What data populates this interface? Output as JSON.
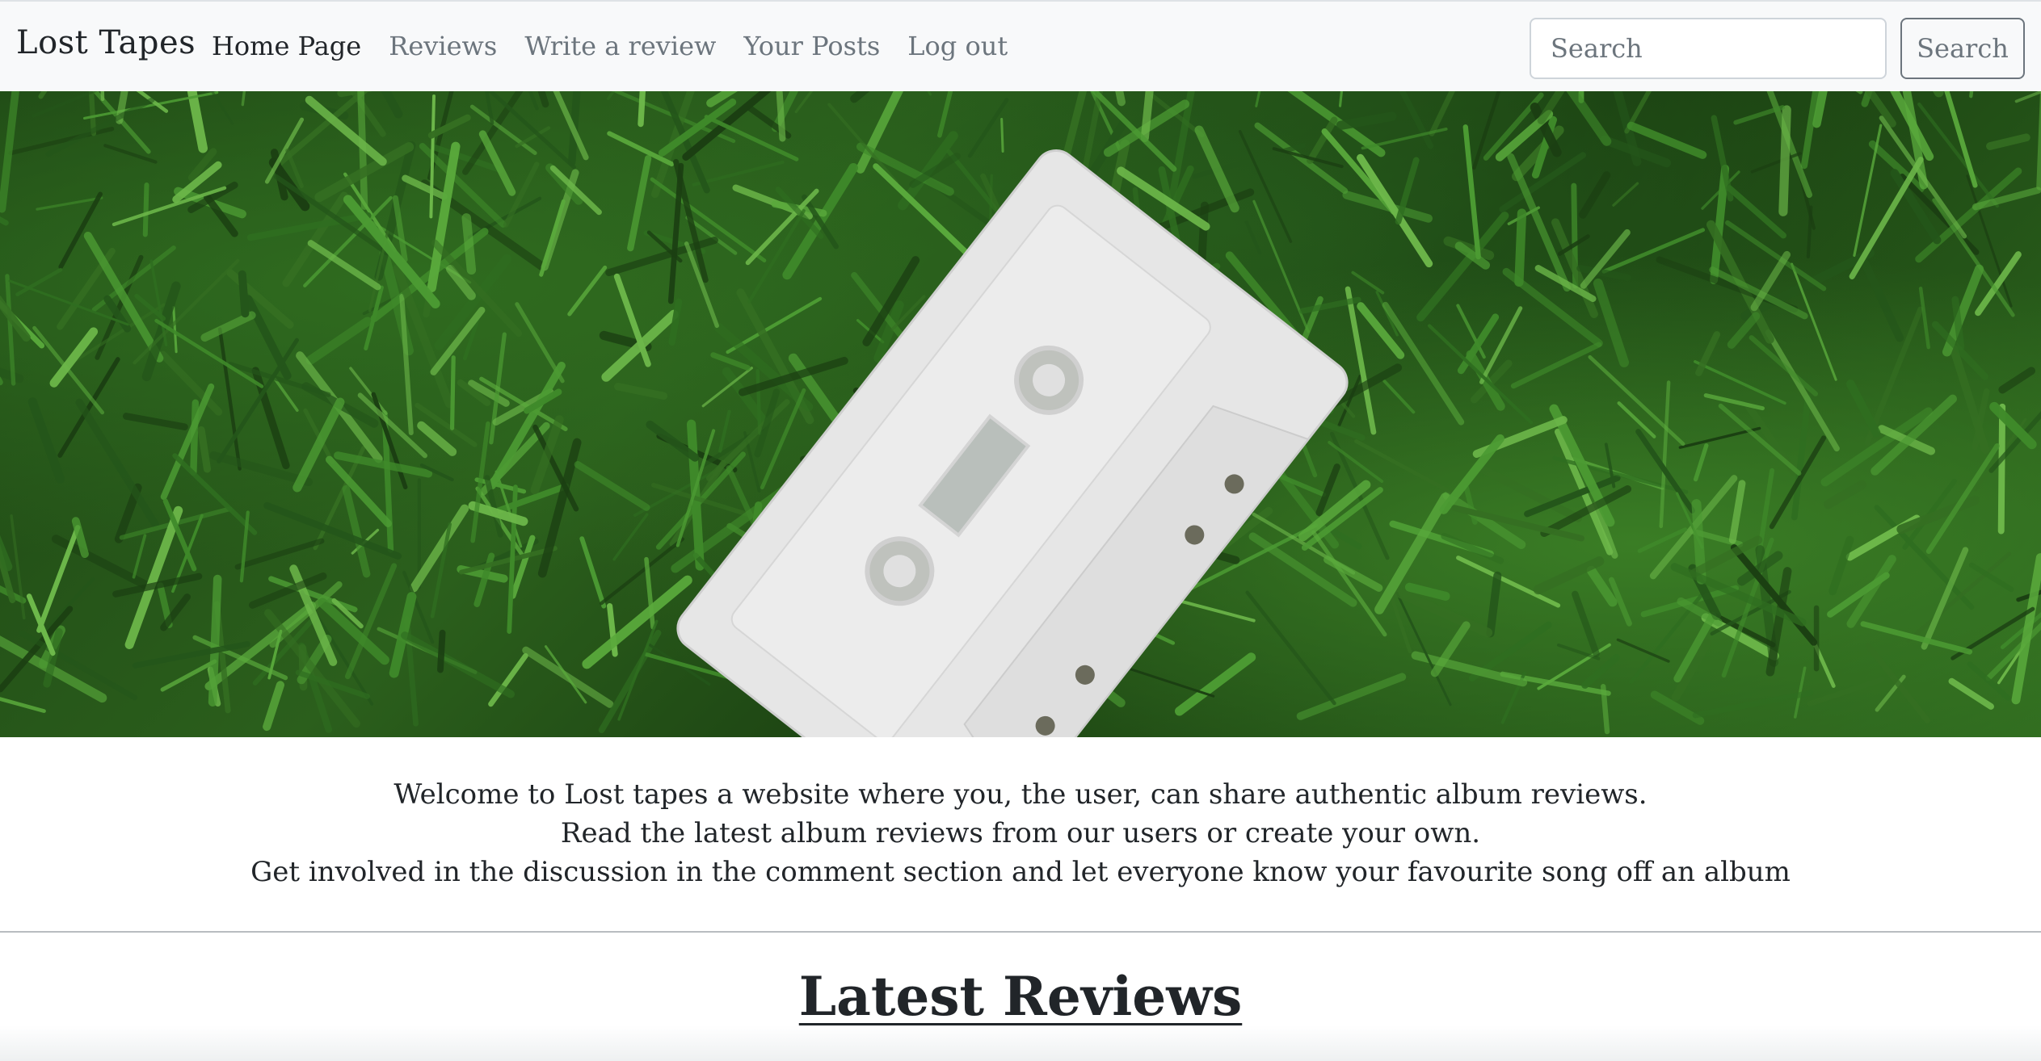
{
  "navbar": {
    "brand": "Lost Tapes",
    "links": [
      {
        "label": "Home Page",
        "active": true
      },
      {
        "label": "Reviews",
        "active": false
      },
      {
        "label": "Write a review",
        "active": false
      },
      {
        "label": "Your Posts",
        "active": false
      },
      {
        "label": "Log out",
        "active": false
      }
    ],
    "search": {
      "placeholder": "Search",
      "value": "",
      "button_label": "Search"
    }
  },
  "welcome": {
    "lines": [
      "Welcome to Lost tapes a website where you, the user, can share authentic album reviews.",
      "Read the latest album reviews from our users or create your own.",
      "Get involved in the discussion in the comment section and let everyone know your favourite song off an album"
    ]
  },
  "latest_reviews": {
    "heading": "Latest Reviews"
  },
  "colors": {
    "navbar_bg": "#f8f9fa",
    "link_active": "#212529",
    "link_muted": "#6c757d",
    "grass": "#2b5f1c",
    "cassette": "#e4e4e4"
  }
}
